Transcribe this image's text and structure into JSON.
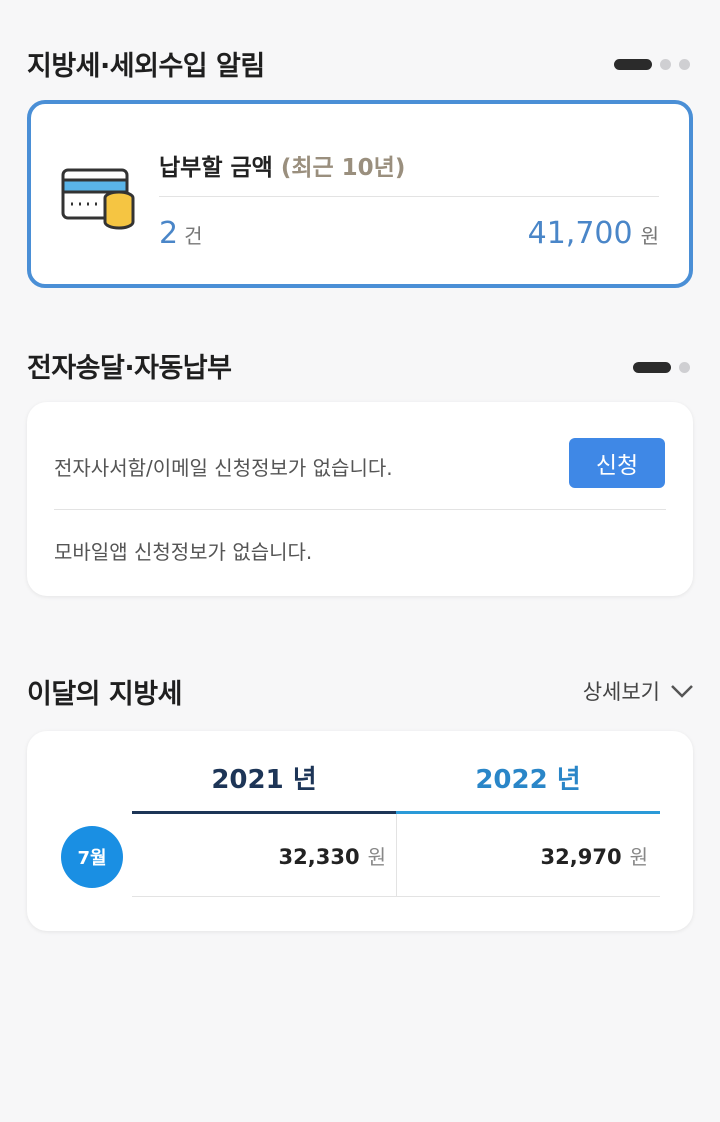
{
  "alerts": {
    "title": "지방세·세외수입 알림",
    "heading": "납부할 금액",
    "heading_sub": "(최근 10년)",
    "count": "2",
    "count_unit": "건",
    "amount": "41,700",
    "amount_unit": "원"
  },
  "delivery": {
    "title": "전자송달·자동납부",
    "email_status": "전자사서함/이메일 신청정보가 없습니다.",
    "apply_label": "신청",
    "mobile_status": "모바일앱 신청정보가 없습니다."
  },
  "monthly": {
    "title": "이달의 지방세",
    "detail_label": "상세보기",
    "years": [
      {
        "label": "2021 년",
        "value": "32,330",
        "unit": "원"
      },
      {
        "label": "2022 년",
        "value": "32,970",
        "unit": "원"
      }
    ],
    "month_label": "7월"
  }
}
